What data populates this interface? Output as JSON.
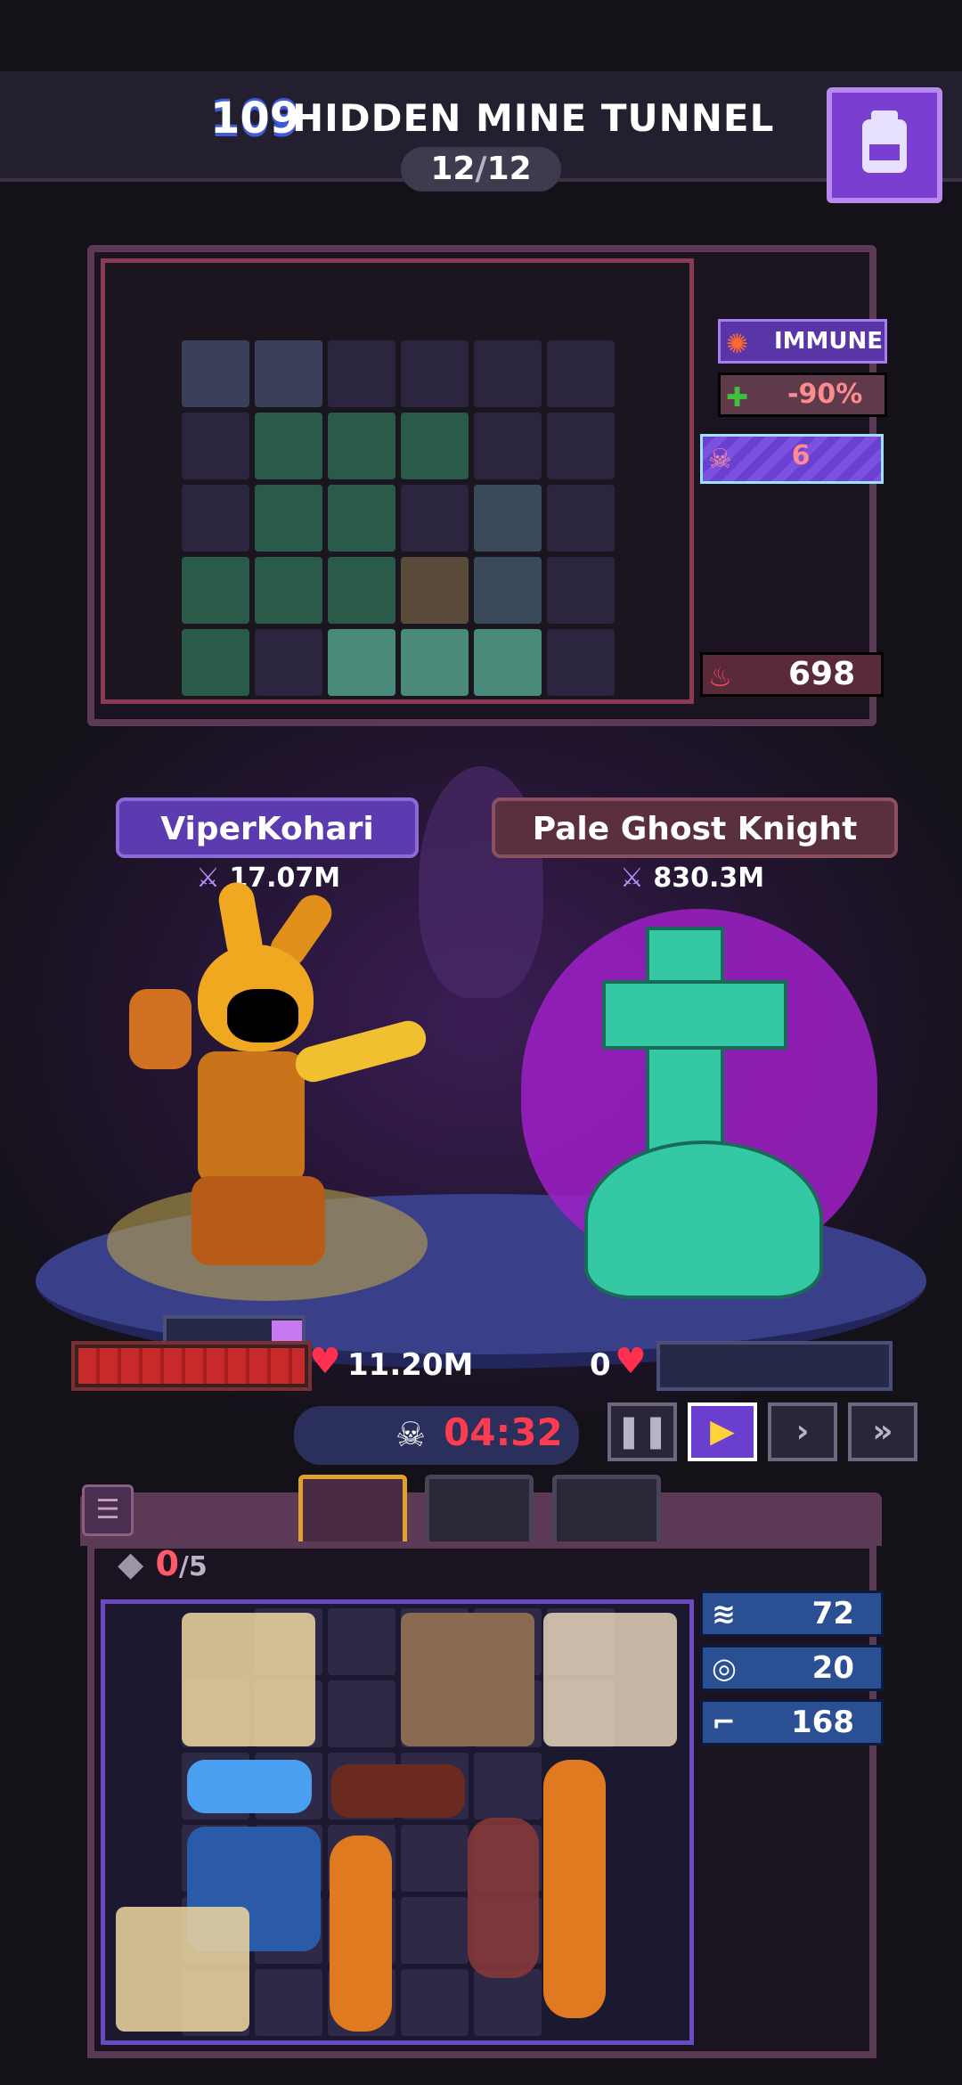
{
  "header": {
    "stage_number": "109",
    "stage_name": "HIDDEN MINE TUNNEL",
    "progress_current": "12",
    "progress_total": "12",
    "bag_icon": "backpack-icon"
  },
  "enemy_stats": {
    "immune_label": "IMMUNE",
    "reduction": "-90%",
    "skull_count": "6",
    "power": "698"
  },
  "player": {
    "name": "ViperKohari",
    "attack": "17.07M",
    "hp": "11.20M"
  },
  "enemy": {
    "name": "Pale Ghost Knight",
    "attack": "830.3M",
    "hp": "0"
  },
  "battle": {
    "timer": "04:32"
  },
  "inventory": {
    "slots_used": "0",
    "slots_max": "/5"
  },
  "player_stats": [
    {
      "icon": "speed-icon",
      "value": "72"
    },
    {
      "icon": "target-icon",
      "value": "20"
    },
    {
      "icon": "boot-icon",
      "value": "168"
    }
  ],
  "colors": {
    "accent_purple": "#6a3fd0",
    "hp_red": "#c62a2a",
    "timer_red": "#ff3b50",
    "stat_blue": "#2a4f92"
  }
}
